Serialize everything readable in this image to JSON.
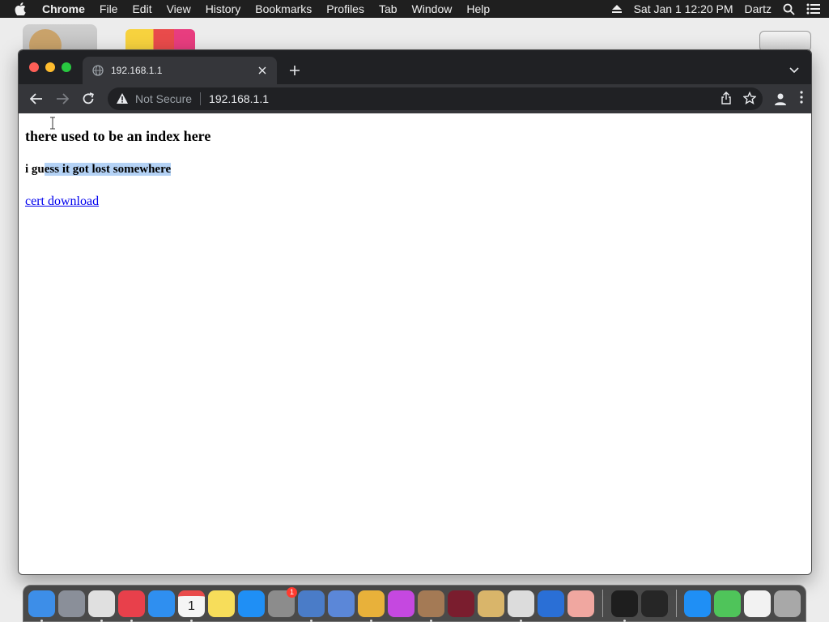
{
  "menubar": {
    "app_name": "Chrome",
    "items": [
      "File",
      "Edit",
      "View",
      "History",
      "Bookmarks",
      "Profiles",
      "Tab",
      "Window",
      "Help"
    ],
    "datetime": "Sat Jan 1  12:20 PM",
    "user": "Dartz"
  },
  "browser": {
    "tab_title": "192.168.1.1",
    "security_label": "Not Secure",
    "url": "192.168.1.1"
  },
  "page": {
    "heading": "there used to be an index here",
    "subheading_before": "i gu",
    "subheading_selected": "ess it got lost somewhere",
    "link_text": "cert download"
  },
  "dock": {
    "calendar_day": "1",
    "sysprefs_badge": "1",
    "apps": [
      {
        "name": "finder-icon",
        "color": "#3d8ee8"
      },
      {
        "name": "launchpad-icon",
        "color": "#8a8f99"
      },
      {
        "name": "chrome-icon",
        "color": "#e0e0e0"
      },
      {
        "name": "fantastical-icon",
        "color": "#e8404b"
      },
      {
        "name": "safari-icon",
        "color": "#2f8ff0"
      },
      {
        "name": "calendar-icon",
        "color": "#f5f5f5"
      },
      {
        "name": "notes-icon",
        "color": "#f7dd5a"
      },
      {
        "name": "app-store-icon",
        "color": "#1f8ff5"
      },
      {
        "name": "system-preferences-icon",
        "color": "#8c8c8c"
      },
      {
        "name": "network-radar-icon",
        "color": "#4a7cc8"
      },
      {
        "name": "snake-app-icon",
        "color": "#5b87d8"
      },
      {
        "name": "cheetah-icon",
        "color": "#e8b13a"
      },
      {
        "name": "flower-app-icon",
        "color": "#c548e0"
      },
      {
        "name": "brown-app-icon",
        "color": "#a47a55"
      },
      {
        "name": "wine-icon",
        "color": "#7a1d2e"
      },
      {
        "name": "palette-icon",
        "color": "#d9b56a"
      },
      {
        "name": "vm-app-icon",
        "color": "#dcdcdc"
      },
      {
        "name": "g-app-icon",
        "color": "#2a6fd6"
      },
      {
        "name": "anime-app-icon",
        "color": "#f0a7a0"
      },
      {
        "name": "terminal-icon",
        "color": "#1e1e1e"
      },
      {
        "name": "console-icon",
        "color": "#262626"
      },
      {
        "name": "app-store-2-icon",
        "color": "#1f8ff5"
      },
      {
        "name": "colorful-app-icon",
        "color": "#4fc45a"
      },
      {
        "name": "hello-app-icon",
        "color": "#f2f2f2"
      },
      {
        "name": "trash-icon",
        "color": "#a8a8a8"
      }
    ]
  }
}
